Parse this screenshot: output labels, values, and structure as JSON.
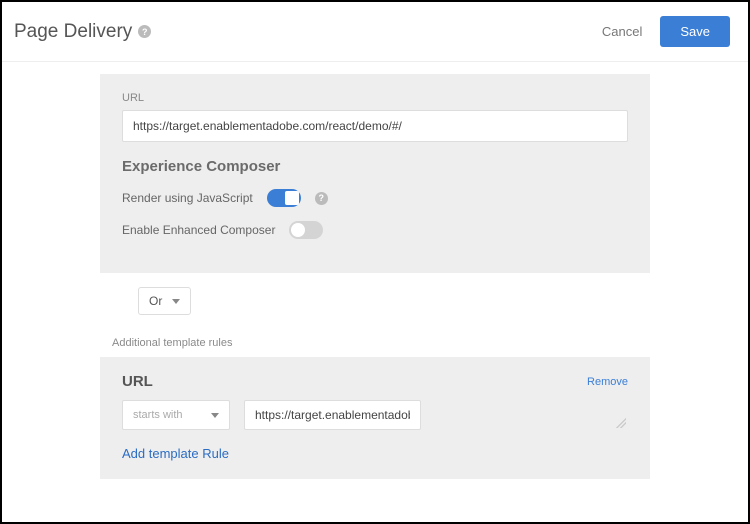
{
  "header": {
    "title": "Page Delivery",
    "cancel": "Cancel",
    "save": "Save"
  },
  "card1": {
    "url_label": "URL",
    "url_value": "https://target.enablementadobe.com/react/demo/#/",
    "composer_heading": "Experience Composer",
    "render_js_label": "Render using JavaScript",
    "enhanced_label": "Enable Enhanced Composer"
  },
  "connector": {
    "value": "Or"
  },
  "additional_label": "Additional template rules",
  "card2": {
    "heading": "URL",
    "remove": "Remove",
    "operator": "starts with",
    "value": "https://target.enablementadobe.com/react/demo/#/",
    "add_rule": "Add template Rule"
  }
}
